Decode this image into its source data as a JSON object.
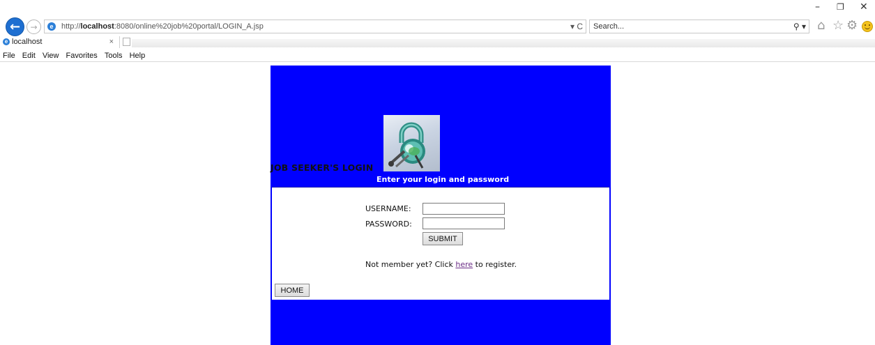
{
  "window_controls": {
    "minimize": "–",
    "restore": "❐",
    "close": "✕"
  },
  "address_bar": {
    "url_prefix": "http://",
    "url_host": "localhost",
    "url_rest": ":8080/online%20job%20portal/LOGIN_A.jsp",
    "tools": "▾ C"
  },
  "search": {
    "placeholder": "Search...",
    "tools": "⚲ ▾"
  },
  "tab": {
    "title": "localhost",
    "close": "×"
  },
  "menu": {
    "items": [
      "File",
      "Edit",
      "View",
      "Favorites",
      "Tools",
      "Help"
    ]
  },
  "page": {
    "heading": "JOB SEEKER'S LOGIN",
    "subheading": "Enter your login and password",
    "username_label": "USERNAME:",
    "password_label": "PASSWORD:",
    "username_value": "",
    "password_value": "",
    "submit_label": "SUBMIT",
    "register_prefix": "Not member yet? Click ",
    "register_link": "here",
    "register_suffix": " to register.",
    "home_label": "HOME"
  },
  "colors": {
    "page_background": "#0000ff",
    "panel": "#ffffff",
    "link": "#6b2d86",
    "back_button": "#1e6fd1"
  },
  "icons": [
    "back-arrow-icon",
    "forward-arrow-icon",
    "ie-icon",
    "refresh-icon",
    "search-icon",
    "home-icon",
    "favorites-star-icon",
    "settings-gear-icon",
    "feedback-smiley-icon",
    "padlock-keys-icon"
  ]
}
